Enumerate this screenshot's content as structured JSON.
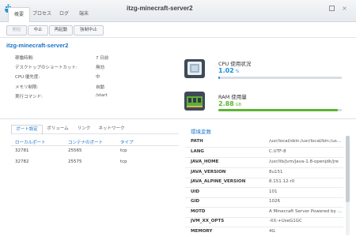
{
  "window": {
    "title": "itzg-minecraft-server2",
    "tabs": [
      {
        "label": "概要",
        "active": true
      },
      {
        "label": "プロセス",
        "active": false
      },
      {
        "label": "ログ",
        "active": false
      },
      {
        "label": "端末",
        "active": false
      }
    ],
    "close_glyph": "×"
  },
  "toolbar": {
    "buttons": [
      {
        "label": "開始",
        "enabled": false
      },
      {
        "label": "中止",
        "enabled": true
      },
      {
        "label": "再起動",
        "enabled": true
      },
      {
        "label": "強制中止",
        "enabled": true
      }
    ]
  },
  "container": {
    "name": "itzg-minecraft-server2",
    "info": [
      {
        "label": "稼働時間:",
        "value": "7 日前"
      },
      {
        "label": "デスクトップのショートカット:",
        "value": "無効"
      },
      {
        "label": "CPU 優先度:",
        "value": "中"
      },
      {
        "label": "メモリ制限:",
        "value": "自動"
      },
      {
        "label": "実行コマンド:",
        "value": "/start"
      }
    ]
  },
  "resources": {
    "cpu": {
      "label": "CPU 使用状況",
      "value": "1.02",
      "unit": "%",
      "fraction": 0.0102,
      "color": "#1a8fd8"
    },
    "ram": {
      "label": "RAM 使用量",
      "value": "2.88",
      "unit": "GB",
      "fraction": 0.97,
      "color": "#5cb531"
    }
  },
  "ports_panel": {
    "tabs": [
      {
        "label": "ポート設定",
        "active": true
      },
      {
        "label": "ボリューム",
        "active": false
      },
      {
        "label": "リンク",
        "active": false
      },
      {
        "label": "ネットワーク",
        "active": false
      }
    ],
    "columns": [
      "ローカルポート",
      "コンテナのポート",
      "タイプ"
    ],
    "rows": [
      [
        "32781",
        "25565",
        "tcp"
      ],
      [
        "32782",
        "25575",
        "tcp"
      ]
    ]
  },
  "environment": {
    "title": "環境変数",
    "rows": [
      {
        "key": "PATH",
        "value": "/usr/local/sbin:/usr/local/bin:/us..."
      },
      {
        "key": "LANG",
        "value": "C.UTF-8"
      },
      {
        "key": "JAVA_HOME",
        "value": "/usr/lib/jvm/java-1.8-openjdk/jre"
      },
      {
        "key": "JAVA_VERSION",
        "value": "8u151"
      },
      {
        "key": "JAVA_ALPINE_VERSION",
        "value": "8.151.12-r0"
      },
      {
        "key": "UID",
        "value": "101"
      },
      {
        "key": "GID",
        "value": "1026"
      },
      {
        "key": "MOTD",
        "value": "A Minecraft Server Powered by D..."
      },
      {
        "key": "JVM_XX_OPTS",
        "value": "-XX:+UseG1GC"
      },
      {
        "key": "MEMORY",
        "value": "4G"
      }
    ]
  }
}
